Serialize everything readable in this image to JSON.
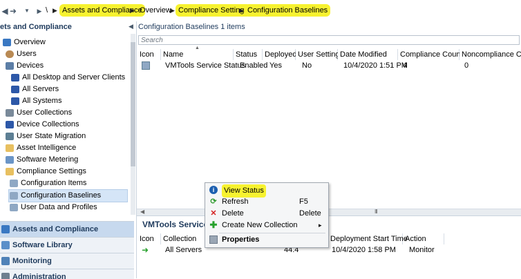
{
  "breadcrumb": {
    "items": [
      "Assets and Compliance",
      "Overview",
      "Compliance Settings",
      "Configuration Baselines"
    ],
    "root_sep": "\\"
  },
  "leftnav": {
    "header": "ets and Compliance",
    "items": [
      {
        "label": "Overview",
        "icon": "overview-icon"
      },
      {
        "label": "Users",
        "icon": "user-icon"
      },
      {
        "label": "Devices",
        "icon": "devices-icon"
      },
      {
        "label": "All Desktop and Server Clients",
        "icon": "collection-icon"
      },
      {
        "label": "All Servers",
        "icon": "collection-icon"
      },
      {
        "label": "All Systems",
        "icon": "collection-icon"
      },
      {
        "label": "User Collections",
        "icon": "user-collections-icon"
      },
      {
        "label": "Device Collections",
        "icon": "device-collections-icon"
      },
      {
        "label": "User State Migration",
        "icon": "migration-icon"
      },
      {
        "label": "Asset Intelligence",
        "icon": "folder-icon"
      },
      {
        "label": "Software Metering",
        "icon": "metering-icon"
      },
      {
        "label": "Compliance Settings",
        "icon": "folder-icon"
      },
      {
        "label": "Configuration Items",
        "icon": "config-item-icon"
      },
      {
        "label": "Configuration Baselines",
        "icon": "baseline-icon"
      },
      {
        "label": "User Data and Profiles",
        "icon": "profile-icon"
      }
    ],
    "workspaces": [
      "Assets and Compliance",
      "Software Library",
      "Monitoring",
      "Administration"
    ]
  },
  "main": {
    "title": "Configuration Baselines 1 items",
    "search_placeholder": "Search",
    "columns": [
      "Icon",
      "Name",
      "Status",
      "Deployed",
      "User Setting",
      "Date Modified",
      "Compliance Count",
      "Noncompliance Count"
    ],
    "rows": [
      {
        "name": "VMTools Service Status",
        "status": "Enabled",
        "deployed": "Yes",
        "user_setting": "No",
        "date_modified": "10/4/2020 1:51 PM",
        "compliance": "4",
        "noncompliance": "0"
      }
    ],
    "splitter_handle": "III"
  },
  "lower": {
    "title": "VMTools Service Sta",
    "columns": [
      "Icon",
      "Collection",
      "Deployment Start Time",
      "Action"
    ],
    "rows": [
      {
        "collection": "All Servers",
        "value": "44.4",
        "start_time": "10/4/2020 1:58 PM",
        "action": "Monitor"
      }
    ]
  },
  "context_menu": {
    "items": [
      {
        "label": "View Status",
        "shortcut": "",
        "icon": "info-icon",
        "color": "#1c5fb0"
      },
      {
        "label": "Refresh",
        "shortcut": "F5",
        "icon": "refresh-icon",
        "color": "#2f9a2f"
      },
      {
        "label": "Delete",
        "shortcut": "Delete",
        "icon": "delete-icon",
        "color": "#d42020"
      },
      {
        "label": "Create New Collection",
        "shortcut": "",
        "icon": "add-icon",
        "color": "#27a12c"
      },
      {
        "label": "Properties",
        "shortcut": "",
        "icon": "properties-icon",
        "color": "#555555"
      }
    ],
    "submenu_arrow": "▸"
  },
  "colors": {
    "highlight": "#f7f230",
    "accent": "#1e3a5c",
    "selection": "#d5e5f7"
  }
}
